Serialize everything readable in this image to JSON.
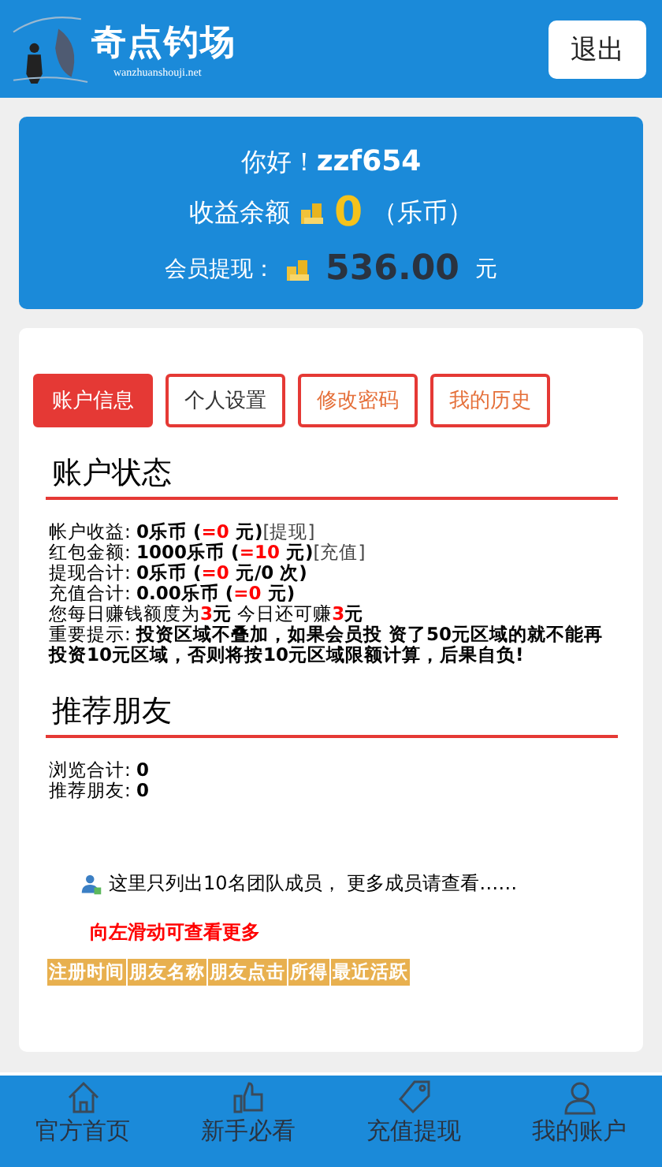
{
  "header": {
    "logo_title": "奇点钓场",
    "logo_domain": "wanzhuanshouji.net",
    "logout": "退出"
  },
  "summary": {
    "greeting": "你好！",
    "username": "zzf654",
    "balance_label": "收益余额",
    "balance": "0",
    "balance_unit": "（乐币）",
    "withdraw_label": "会员提现：",
    "withdraw_amount": "536.00",
    "withdraw_unit": "元"
  },
  "tabs": [
    {
      "label": "账户信息",
      "selected": true
    },
    {
      "label": "个人设置",
      "selected": false
    },
    {
      "label": "修改密码",
      "selected": false
    },
    {
      "label": "我的历史",
      "selected": false
    }
  ],
  "account_status": {
    "title": "账户状态",
    "lines": [
      {
        "segments": [
          {
            "kind": "plain",
            "text": "帐户收益: "
          },
          {
            "kind": "bold",
            "text": "0乐币 ("
          },
          {
            "kind": "red",
            "text": "=0"
          },
          {
            "kind": "bold",
            "text": " 元)"
          }
        ],
        "link": "[提现]"
      },
      {
        "segments": [
          {
            "kind": "plain",
            "text": "红包金额: "
          },
          {
            "kind": "bold",
            "text": "1000乐币 ("
          },
          {
            "kind": "red",
            "text": "=10"
          },
          {
            "kind": "bold",
            "text": " 元)"
          }
        ],
        "link": "[充值]"
      },
      {
        "segments": [
          {
            "kind": "plain",
            "text": "提现合计: "
          },
          {
            "kind": "bold",
            "text": "0乐币 ("
          },
          {
            "kind": "red",
            "text": "=0"
          },
          {
            "kind": "bold",
            "text": " 元/0 次)"
          }
        ]
      },
      {
        "segments": [
          {
            "kind": "plain",
            "text": "充值合计: "
          },
          {
            "kind": "bold",
            "text": "0.00乐币 ("
          },
          {
            "kind": "red",
            "text": "=0"
          },
          {
            "kind": "bold",
            "text": " 元)"
          }
        ]
      },
      {
        "segments": [
          {
            "kind": "plain",
            "text": "您每日赚钱额度为"
          },
          {
            "kind": "red",
            "text": "3"
          },
          {
            "kind": "bold",
            "text": "元"
          },
          {
            "kind": "plain",
            "text": " 今日还可赚"
          },
          {
            "kind": "red",
            "text": "3"
          },
          {
            "kind": "bold",
            "text": "元"
          }
        ]
      },
      {
        "segments": [
          {
            "kind": "plain",
            "text": "重要提示: "
          },
          {
            "kind": "bold",
            "text": "投资区域不叠加，如果会员投 资了50元区域的就不能再投资10元区域，否则将按10元区域限额计算，后果自负!"
          }
        ]
      }
    ]
  },
  "friends": {
    "title": "推荐朋友",
    "lines": [
      {
        "segments": [
          {
            "kind": "plain",
            "text": "浏览合计: "
          },
          {
            "kind": "bold",
            "text": "0"
          }
        ]
      },
      {
        "segments": [
          {
            "kind": "plain",
            "text": "推荐朋友: "
          },
          {
            "kind": "bold",
            "text": "0"
          }
        ]
      }
    ],
    "notice": "这里只列出10名团队成员， 更多成员请查看……",
    "swipe_hint": "向左滑动可查看更多",
    "columns": [
      "注册时间",
      "朋友名称",
      "朋友点击",
      "所得",
      "最近活跃"
    ]
  },
  "bottom_nav": [
    {
      "label": "官方首页",
      "kind": "home"
    },
    {
      "label": "新手必看",
      "kind": "thumb"
    },
    {
      "label": "充值提现",
      "kind": "tag"
    },
    {
      "label": "我的账户",
      "kind": "user"
    }
  ]
}
